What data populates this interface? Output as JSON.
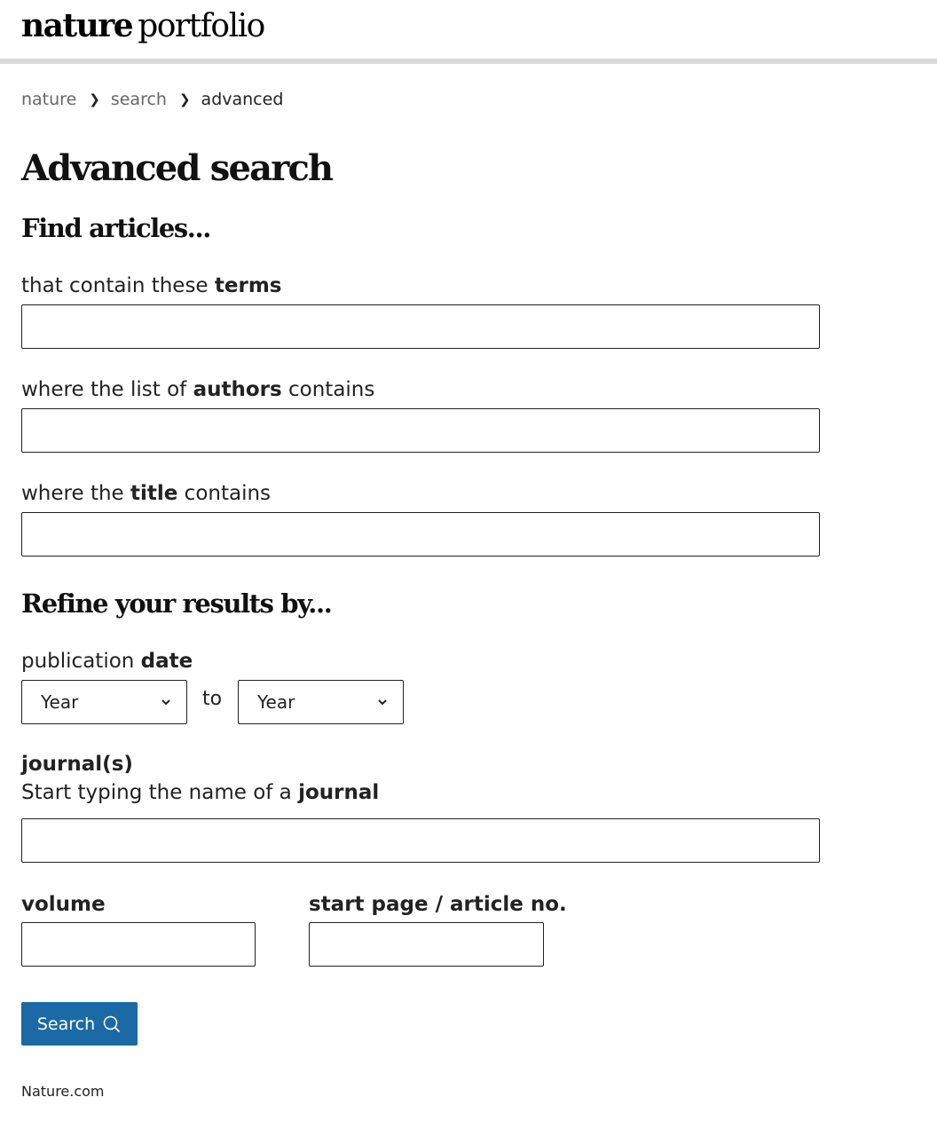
{
  "header": {
    "logo_bold": "nature",
    "logo_light": "portfolio"
  },
  "breadcrumb": [
    "nature",
    "search",
    "advanced"
  ],
  "page_title": "Advanced search",
  "find": {
    "title": "Find articles...",
    "terms_prefix": "that contain these ",
    "terms_bold": "terms",
    "terms_value": "",
    "authors_prefix": "where the list of ",
    "authors_bold": "authors",
    "authors_suffix": " contains",
    "authors_value": "",
    "title_prefix": "where the ",
    "title_bold": "title",
    "title_suffix": " contains",
    "title_value": ""
  },
  "refine": {
    "title": "Refine your results by...",
    "date_prefix": "publication ",
    "date_bold": "date",
    "year_from": "Year",
    "to_label": "to",
    "year_to": "Year",
    "journal_heading": "journal(s)",
    "journal_prefix": "Start typing the name of a ",
    "journal_bold": "journal",
    "journal_value": "",
    "volume_label": "volume",
    "volume_value": "",
    "page_label": "start page / article no.",
    "page_value": ""
  },
  "search_button": {
    "label": "Search",
    "icon": "search-icon",
    "color": "#1b6aa5"
  },
  "footer": "Nature.com"
}
